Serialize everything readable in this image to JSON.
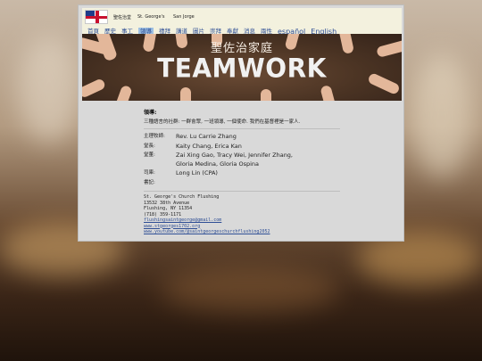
{
  "header": {
    "site_names": [
      "聖佐治堂",
      "St. George's",
      "San Jorge"
    ]
  },
  "nav": {
    "items": [
      {
        "label": "首頁",
        "active": false
      },
      {
        "label": "歷史",
        "active": false
      },
      {
        "label": "事工",
        "active": false
      },
      {
        "label": "領導",
        "active": true
      },
      {
        "label": "禮拜",
        "active": false
      },
      {
        "label": "講道",
        "active": false
      },
      {
        "label": "圖片",
        "active": false
      },
      {
        "label": "崇拜",
        "active": false
      },
      {
        "label": "奉獻",
        "active": false
      },
      {
        "label": "消息",
        "active": false
      },
      {
        "label": "兩性",
        "active": false
      }
    ],
    "languages": [
      "español",
      "English"
    ]
  },
  "banner": {
    "title_zh": "聖佐治家庭",
    "title_en": "TEAMWORK"
  },
  "leadership": {
    "title": "領導:",
    "mission": "三種語言的社群: 一群會眾, 一班領導, 一個使命. 我們在基督裡是一家人.",
    "staff": [
      {
        "role": "主理牧師:",
        "names": [
          "Rev. Lu Carrie Zhang"
        ]
      },
      {
        "role": "堂長:",
        "names": [
          "Kaity Chang, Erica Kan"
        ]
      },
      {
        "role": "堂董:",
        "names": [
          "Zai Xing Gao, Tracy Wei, Jennifer Zhang,",
          "Gloria Medina, Gloria Ospina"
        ]
      },
      {
        "role": "司庫:",
        "names": [
          "Long Lin (CPA)"
        ]
      },
      {
        "role": "書記:",
        "names": [
          ""
        ]
      }
    ]
  },
  "address": {
    "lines": [
      "St. George's Church Flushing",
      "13532 38th Avenue",
      "Flushing, NY 11354",
      "(718) 359-1171"
    ],
    "links": [
      "flushingsaintgeorge@gmail.com",
      "www.stgeorges1702.org",
      "www.youtube.com/@saintgeorgeschurchflushing2052"
    ]
  }
}
